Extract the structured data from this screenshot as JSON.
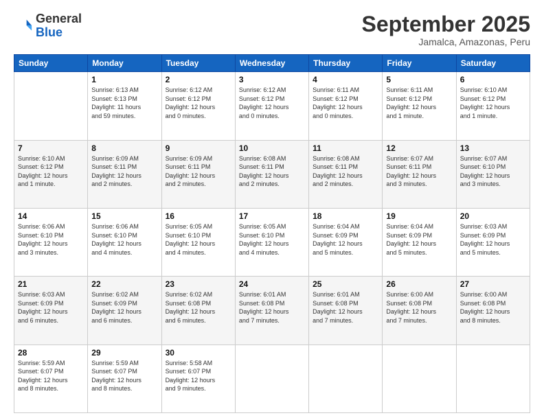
{
  "logo": {
    "general": "General",
    "blue": "Blue"
  },
  "header": {
    "month": "September 2025",
    "location": "Jamalca, Amazonas, Peru"
  },
  "weekdays": [
    "Sunday",
    "Monday",
    "Tuesday",
    "Wednesday",
    "Thursday",
    "Friday",
    "Saturday"
  ],
  "weeks": [
    [
      {
        "day": "",
        "info": ""
      },
      {
        "day": "1",
        "info": "Sunrise: 6:13 AM\nSunset: 6:13 PM\nDaylight: 11 hours\nand 59 minutes."
      },
      {
        "day": "2",
        "info": "Sunrise: 6:12 AM\nSunset: 6:12 PM\nDaylight: 12 hours\nand 0 minutes."
      },
      {
        "day": "3",
        "info": "Sunrise: 6:12 AM\nSunset: 6:12 PM\nDaylight: 12 hours\nand 0 minutes."
      },
      {
        "day": "4",
        "info": "Sunrise: 6:11 AM\nSunset: 6:12 PM\nDaylight: 12 hours\nand 0 minutes."
      },
      {
        "day": "5",
        "info": "Sunrise: 6:11 AM\nSunset: 6:12 PM\nDaylight: 12 hours\nand 1 minute."
      },
      {
        "day": "6",
        "info": "Sunrise: 6:10 AM\nSunset: 6:12 PM\nDaylight: 12 hours\nand 1 minute."
      }
    ],
    [
      {
        "day": "7",
        "info": "Sunrise: 6:10 AM\nSunset: 6:12 PM\nDaylight: 12 hours\nand 1 minute."
      },
      {
        "day": "8",
        "info": "Sunrise: 6:09 AM\nSunset: 6:11 PM\nDaylight: 12 hours\nand 2 minutes."
      },
      {
        "day": "9",
        "info": "Sunrise: 6:09 AM\nSunset: 6:11 PM\nDaylight: 12 hours\nand 2 minutes."
      },
      {
        "day": "10",
        "info": "Sunrise: 6:08 AM\nSunset: 6:11 PM\nDaylight: 12 hours\nand 2 minutes."
      },
      {
        "day": "11",
        "info": "Sunrise: 6:08 AM\nSunset: 6:11 PM\nDaylight: 12 hours\nand 2 minutes."
      },
      {
        "day": "12",
        "info": "Sunrise: 6:07 AM\nSunset: 6:11 PM\nDaylight: 12 hours\nand 3 minutes."
      },
      {
        "day": "13",
        "info": "Sunrise: 6:07 AM\nSunset: 6:10 PM\nDaylight: 12 hours\nand 3 minutes."
      }
    ],
    [
      {
        "day": "14",
        "info": "Sunrise: 6:06 AM\nSunset: 6:10 PM\nDaylight: 12 hours\nand 3 minutes."
      },
      {
        "day": "15",
        "info": "Sunrise: 6:06 AM\nSunset: 6:10 PM\nDaylight: 12 hours\nand 4 minutes."
      },
      {
        "day": "16",
        "info": "Sunrise: 6:05 AM\nSunset: 6:10 PM\nDaylight: 12 hours\nand 4 minutes."
      },
      {
        "day": "17",
        "info": "Sunrise: 6:05 AM\nSunset: 6:10 PM\nDaylight: 12 hours\nand 4 minutes."
      },
      {
        "day": "18",
        "info": "Sunrise: 6:04 AM\nSunset: 6:09 PM\nDaylight: 12 hours\nand 5 minutes."
      },
      {
        "day": "19",
        "info": "Sunrise: 6:04 AM\nSunset: 6:09 PM\nDaylight: 12 hours\nand 5 minutes."
      },
      {
        "day": "20",
        "info": "Sunrise: 6:03 AM\nSunset: 6:09 PM\nDaylight: 12 hours\nand 5 minutes."
      }
    ],
    [
      {
        "day": "21",
        "info": "Sunrise: 6:03 AM\nSunset: 6:09 PM\nDaylight: 12 hours\nand 6 minutes."
      },
      {
        "day": "22",
        "info": "Sunrise: 6:02 AM\nSunset: 6:09 PM\nDaylight: 12 hours\nand 6 minutes."
      },
      {
        "day": "23",
        "info": "Sunrise: 6:02 AM\nSunset: 6:08 PM\nDaylight: 12 hours\nand 6 minutes."
      },
      {
        "day": "24",
        "info": "Sunrise: 6:01 AM\nSunset: 6:08 PM\nDaylight: 12 hours\nand 7 minutes."
      },
      {
        "day": "25",
        "info": "Sunrise: 6:01 AM\nSunset: 6:08 PM\nDaylight: 12 hours\nand 7 minutes."
      },
      {
        "day": "26",
        "info": "Sunrise: 6:00 AM\nSunset: 6:08 PM\nDaylight: 12 hours\nand 7 minutes."
      },
      {
        "day": "27",
        "info": "Sunrise: 6:00 AM\nSunset: 6:08 PM\nDaylight: 12 hours\nand 8 minutes."
      }
    ],
    [
      {
        "day": "28",
        "info": "Sunrise: 5:59 AM\nSunset: 6:07 PM\nDaylight: 12 hours\nand 8 minutes."
      },
      {
        "day": "29",
        "info": "Sunrise: 5:59 AM\nSunset: 6:07 PM\nDaylight: 12 hours\nand 8 minutes."
      },
      {
        "day": "30",
        "info": "Sunrise: 5:58 AM\nSunset: 6:07 PM\nDaylight: 12 hours\nand 9 minutes."
      },
      {
        "day": "",
        "info": ""
      },
      {
        "day": "",
        "info": ""
      },
      {
        "day": "",
        "info": ""
      },
      {
        "day": "",
        "info": ""
      }
    ]
  ]
}
